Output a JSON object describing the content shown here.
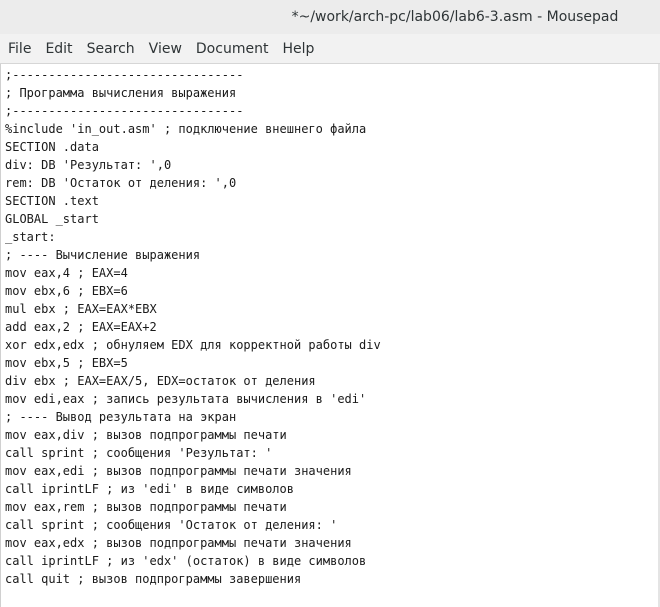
{
  "window": {
    "title": "*~/work/arch-pc/lab06/lab6-3.asm - Mousepad"
  },
  "menu": [
    {
      "label": "File"
    },
    {
      "label": "Edit"
    },
    {
      "label": "Search"
    },
    {
      "label": "View"
    },
    {
      "label": "Document"
    },
    {
      "label": "Help"
    }
  ],
  "editor": {
    "lines": [
      ";--------------------------------",
      "; Программа вычисления выражения",
      ";--------------------------------",
      "%include 'in_out.asm' ; подключение внешнего файла",
      "SECTION .data",
      "div: DB 'Результат: ',0",
      "rem: DB 'Остаток от деления: ',0",
      "SECTION .text",
      "GLOBAL _start",
      "_start:",
      "; ---- Вычисление выражения",
      "mov eax,4 ; EAX=4",
      "mov ebx,6 ; EBX=6",
      "mul ebx ; EAX=EAX*EBX",
      "add eax,2 ; EAX=EAX+2",
      "xor edx,edx ; обнуляем EDX для корректной работы div",
      "mov ebx,5 ; EBX=5",
      "div ebx ; EAX=EAX/5, EDX=остаток от деления",
      "mov edi,eax ; запись результата вычисления в 'edi'",
      "; ---- Вывод результата на экран",
      "mov eax,div ; вызов подпрограммы печати",
      "call sprint ; сообщения 'Результат: '",
      "mov eax,edi ; вызов подпрограммы печати значения",
      "call iprintLF ; из 'edi' в виде символов",
      "mov eax,rem ; вызов подпрограммы печати",
      "call sprint ; сообщения 'Остаток от деления: '",
      "mov eax,edx ; вызов подпрограммы печати значения",
      "call iprintLF ; из 'edx' (остаток) в виде символов",
      "call quit ; вызов подпрограммы завершения"
    ]
  }
}
